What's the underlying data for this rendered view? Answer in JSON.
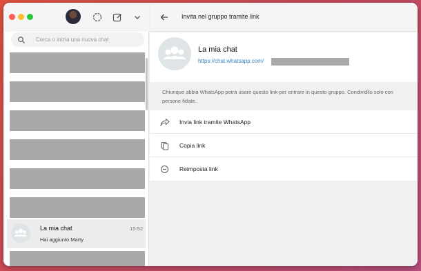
{
  "window": {
    "background": "#f0f0f0"
  },
  "sidebar": {
    "search": {
      "placeholder": "Cerca o inizia una nuova chat"
    },
    "chats": [
      {
        "name": "La mia chat",
        "time": "15:52",
        "preview": "Hai aggiunto Marty"
      }
    ],
    "icons": [
      "status-icon",
      "new-chat-icon",
      "menu-chevron-icon"
    ]
  },
  "main": {
    "header": {
      "title": "Invita nel gruppo tramite link"
    },
    "group": {
      "name": "La mia chat",
      "link": "https://chat.whatsapp.com/"
    },
    "info": "Chiunque abbia WhatsApp potrà usare questo link per entrare in questo gruppo. Condividilo solo con persone fidate.",
    "actions": [
      {
        "label": "Invia link tramite WhatsApp",
        "icon": "share-icon"
      },
      {
        "label": "Copia link",
        "icon": "copy-icon"
      },
      {
        "label": "Reimposta link",
        "icon": "revoke-icon"
      }
    ]
  },
  "colors": {
    "link": "#3483c7",
    "accent": "#28c840"
  }
}
